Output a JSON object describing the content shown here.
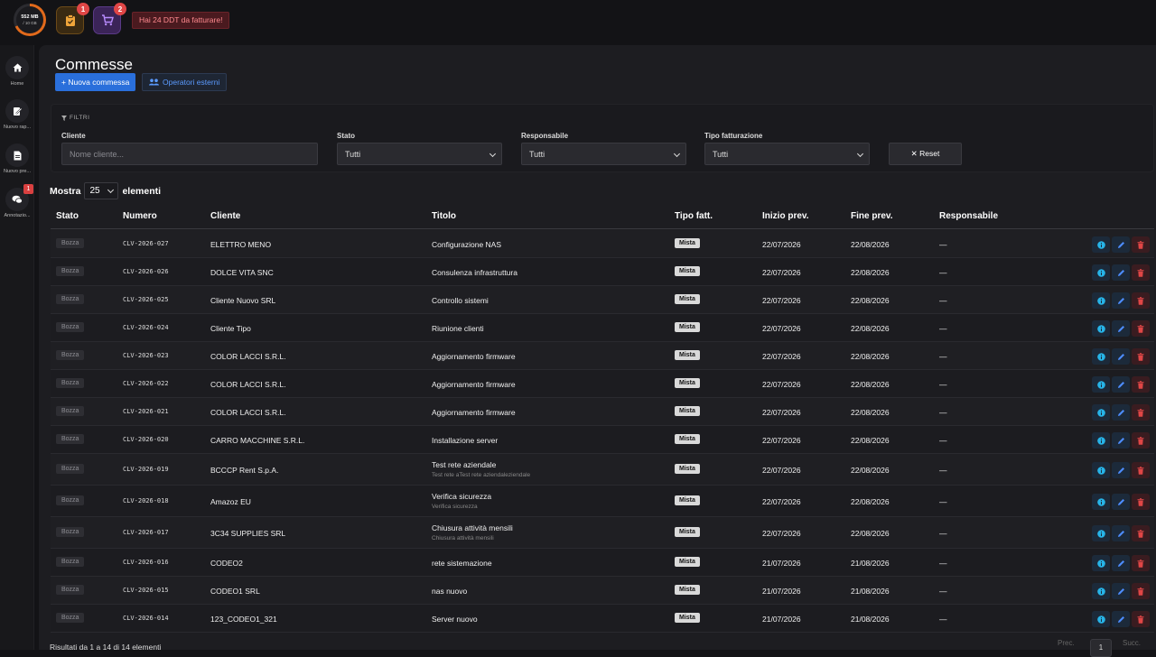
{
  "topbar": {
    "storage_used": "552 MB",
    "storage_total": "/ 10 GB",
    "orders_count": "1",
    "cart_count": "2",
    "alert": "Hai 24 DDT da fatturare!"
  },
  "sidebar": {
    "items": [
      {
        "label": "Home",
        "icon": "home-icon"
      },
      {
        "label": "Nuovo rap...",
        "icon": "report-icon"
      },
      {
        "label": "Nuovo pre...",
        "icon": "document-icon"
      },
      {
        "label": "Annotazio...",
        "icon": "chat-icon",
        "badge": "1"
      }
    ]
  },
  "page": {
    "title": "Commesse",
    "new_button": "+ Nuova commessa",
    "external_button": "Operatori esterni"
  },
  "filters": {
    "title": "FILTRI",
    "cliente_label": "Cliente",
    "cliente_placeholder": "Nome cliente...",
    "stato_label": "Stato",
    "stato_value": "Tutti",
    "responsabile_label": "Responsabile",
    "responsabile_value": "Tutti",
    "tipo_label": "Tipo fatturazione",
    "tipo_value": "Tutti",
    "reset_label": "✕ Reset"
  },
  "show": {
    "prefix": "Mostra",
    "value": "25",
    "suffix": "elementi"
  },
  "table": {
    "headers": [
      "Stato",
      "Numero",
      "Cliente",
      "Titolo",
      "Tipo fatt.",
      "Inizio prev.",
      "Fine prev.",
      "Responsabile"
    ],
    "rows": [
      {
        "stato": "Bozza",
        "numero": "CLV-2026-027",
        "cliente": "ELETTRO MENO",
        "titolo": "Configurazione NAS",
        "sub": "",
        "tipo": "Mista",
        "inizio": "22/07/2026",
        "fine": "22/08/2026",
        "resp": "—"
      },
      {
        "stato": "Bozza",
        "numero": "CLV-2026-026",
        "cliente": "DOLCE VITA SNC",
        "titolo": "Consulenza infrastruttura",
        "sub": "",
        "tipo": "Mista",
        "inizio": "22/07/2026",
        "fine": "22/08/2026",
        "resp": "—"
      },
      {
        "stato": "Bozza",
        "numero": "CLV-2026-025",
        "cliente": "Cliente Nuovo SRL",
        "titolo": "Controllo sistemi",
        "sub": "",
        "tipo": "Mista",
        "inizio": "22/07/2026",
        "fine": "22/08/2026",
        "resp": "—"
      },
      {
        "stato": "Bozza",
        "numero": "CLV-2026-024",
        "cliente": "Cliente Tipo",
        "titolo": "Riunione clienti",
        "sub": "",
        "tipo": "Mista",
        "inizio": "22/07/2026",
        "fine": "22/08/2026",
        "resp": "—"
      },
      {
        "stato": "Bozza",
        "numero": "CLV-2026-023",
        "cliente": "COLOR LACCI S.R.L.",
        "titolo": "Aggiornamento firmware",
        "sub": "",
        "tipo": "Mista",
        "inizio": "22/07/2026",
        "fine": "22/08/2026",
        "resp": "—"
      },
      {
        "stato": "Bozza",
        "numero": "CLV-2026-022",
        "cliente": "COLOR LACCI S.R.L.",
        "titolo": "Aggiornamento firmware",
        "sub": "",
        "tipo": "Mista",
        "inizio": "22/07/2026",
        "fine": "22/08/2026",
        "resp": "—"
      },
      {
        "stato": "Bozza",
        "numero": "CLV-2026-021",
        "cliente": "COLOR LACCI S.R.L.",
        "titolo": "Aggiornamento firmware",
        "sub": "",
        "tipo": "Mista",
        "inizio": "22/07/2026",
        "fine": "22/08/2026",
        "resp": "—"
      },
      {
        "stato": "Bozza",
        "numero": "CLV-2026-020",
        "cliente": "CARRO MACCHINE S.R.L.",
        "titolo": "Installazione server",
        "sub": "",
        "tipo": "Mista",
        "inizio": "22/07/2026",
        "fine": "22/08/2026",
        "resp": "—"
      },
      {
        "stato": "Bozza",
        "numero": "CLV-2026-019",
        "cliente": "BCCCP Rent S.p.A.",
        "titolo": "Test rete aziendale",
        "sub": "Test rete aTest rete aziendaleziendale",
        "tipo": "Mista",
        "inizio": "22/07/2026",
        "fine": "22/08/2026",
        "resp": "—"
      },
      {
        "stato": "Bozza",
        "numero": "CLV-2026-018",
        "cliente": "Amazoz EU",
        "titolo": "Verifica sicurezza",
        "sub": "Verifica sicurezza",
        "tipo": "Mista",
        "inizio": "22/07/2026",
        "fine": "22/08/2026",
        "resp": "—"
      },
      {
        "stato": "Bozza",
        "numero": "CLV-2026-017",
        "cliente": "3C34 SUPPLIES SRL",
        "titolo": "Chiusura attività mensili",
        "sub": "Chiusura attività mensili",
        "tipo": "Mista",
        "inizio": "22/07/2026",
        "fine": "22/08/2026",
        "resp": "—"
      },
      {
        "stato": "Bozza",
        "numero": "CLV-2026-016",
        "cliente": "CODEO2",
        "titolo": "rete sistemazione",
        "sub": "",
        "tipo": "Mista",
        "inizio": "21/07/2026",
        "fine": "21/08/2026",
        "resp": "—"
      },
      {
        "stato": "Bozza",
        "numero": "CLV-2026-015",
        "cliente": "CODEO1 SRL",
        "titolo": "nas nuovo",
        "sub": "",
        "tipo": "Mista",
        "inizio": "21/07/2026",
        "fine": "21/08/2026",
        "resp": "—"
      },
      {
        "stato": "Bozza",
        "numero": "CLV-2026-014",
        "cliente": "123_CODEO1_321",
        "titolo": "Server nuovo",
        "sub": "",
        "tipo": "Mista",
        "inizio": "21/07/2026",
        "fine": "21/08/2026",
        "resp": "—"
      }
    ]
  },
  "footer": {
    "results": "Risultati da 1 a 14 di 14 elementi",
    "prev": "Prec.",
    "page": "1",
    "next": "Succ."
  },
  "colors": {
    "accent": "#2a6fdb",
    "storage_ring": "#e26a1b",
    "alert_bg": "#4a1a1f",
    "delete": "#e04646"
  }
}
